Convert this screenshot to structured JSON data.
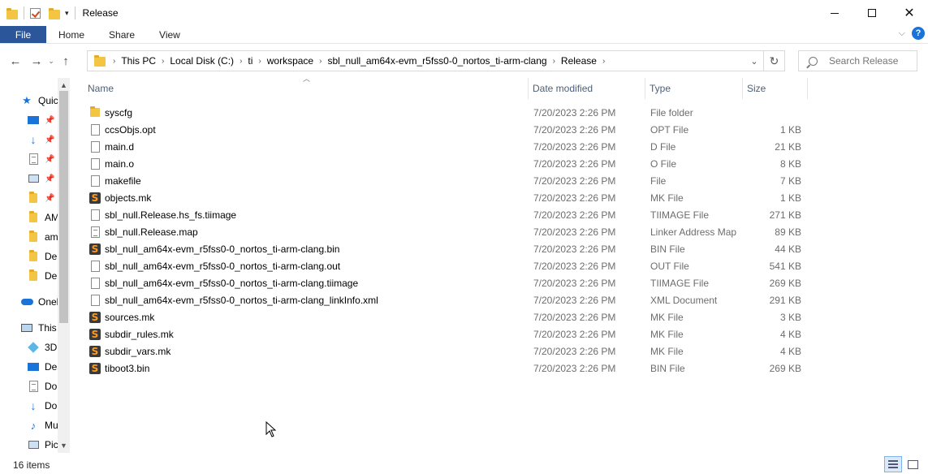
{
  "window": {
    "title": "Release"
  },
  "ribbon": {
    "tabs": [
      {
        "label": "File"
      },
      {
        "label": "Home"
      },
      {
        "label": "Share"
      },
      {
        "label": "View"
      }
    ]
  },
  "address": {
    "crumbs": [
      "This PC",
      "Local Disk (C:)",
      "ti",
      "workspace",
      "sbl_null_am64x-evm_r5fss0-0_nortos_ti-arm-clang",
      "Release"
    ]
  },
  "search": {
    "placeholder": "Search Release"
  },
  "navpane": {
    "items": [
      {
        "label": "Quic",
        "icon": "star-icon"
      },
      {
        "label": "",
        "icon": "desktop-icon",
        "pinned": true
      },
      {
        "label": "",
        "icon": "download-icon",
        "pinned": true
      },
      {
        "label": "",
        "icon": "document-icon",
        "pinned": true
      },
      {
        "label": "",
        "icon": "picture-icon",
        "pinned": true
      },
      {
        "label": "",
        "icon": "folder-icon",
        "pinned": true
      },
      {
        "label": "AM",
        "icon": "folder-icon"
      },
      {
        "label": "am",
        "icon": "folder-icon"
      },
      {
        "label": "Del",
        "icon": "folder-icon"
      },
      {
        "label": "Del",
        "icon": "folder-icon"
      },
      {
        "label": "Onel",
        "icon": "cloud-icon"
      },
      {
        "label": "This",
        "icon": "pc-icon"
      },
      {
        "label": "3D",
        "icon": "3d-objects-icon"
      },
      {
        "label": "Des",
        "icon": "desktop-icon"
      },
      {
        "label": "Do",
        "icon": "document-icon"
      },
      {
        "label": "Do",
        "icon": "download-icon"
      },
      {
        "label": "Mu",
        "icon": "music-icon"
      },
      {
        "label": "Pic",
        "icon": "picture-icon"
      }
    ]
  },
  "columns": {
    "name": "Name",
    "date": "Date modified",
    "type": "Type",
    "size": "Size"
  },
  "files": [
    {
      "name": "syscfg",
      "date": "7/20/2023 2:26 PM",
      "type": "File folder",
      "size": "",
      "icon": "folder-icon"
    },
    {
      "name": "ccsObjs.opt",
      "date": "7/20/2023 2:26 PM",
      "type": "OPT File",
      "size": "1 KB",
      "icon": "file-icon"
    },
    {
      "name": "main.d",
      "date": "7/20/2023 2:26 PM",
      "type": "D File",
      "size": "21 KB",
      "icon": "file-icon"
    },
    {
      "name": "main.o",
      "date": "7/20/2023 2:26 PM",
      "type": "O File",
      "size": "8 KB",
      "icon": "file-icon"
    },
    {
      "name": "makefile",
      "date": "7/20/2023 2:26 PM",
      "type": "File",
      "size": "7 KB",
      "icon": "file-icon"
    },
    {
      "name": "objects.mk",
      "date": "7/20/2023 2:26 PM",
      "type": "MK File",
      "size": "1 KB",
      "icon": "sublime-icon"
    },
    {
      "name": "sbl_null.Release.hs_fs.tiimage",
      "date": "7/20/2023 2:26 PM",
      "type": "TIIMAGE File",
      "size": "271 KB",
      "icon": "file-icon"
    },
    {
      "name": "sbl_null.Release.map",
      "date": "7/20/2023 2:26 PM",
      "type": "Linker Address Map",
      "size": "89 KB",
      "icon": "text-file-icon"
    },
    {
      "name": "sbl_null_am64x-evm_r5fss0-0_nortos_ti-arm-clang.bin",
      "date": "7/20/2023 2:26 PM",
      "type": "BIN File",
      "size": "44 KB",
      "icon": "sublime-icon"
    },
    {
      "name": "sbl_null_am64x-evm_r5fss0-0_nortos_ti-arm-clang.out",
      "date": "7/20/2023 2:26 PM",
      "type": "OUT File",
      "size": "541 KB",
      "icon": "file-icon"
    },
    {
      "name": "sbl_null_am64x-evm_r5fss0-0_nortos_ti-arm-clang.tiimage",
      "date": "7/20/2023 2:26 PM",
      "type": "TIIMAGE File",
      "size": "269 KB",
      "icon": "file-icon"
    },
    {
      "name": "sbl_null_am64x-evm_r5fss0-0_nortos_ti-arm-clang_linkInfo.xml",
      "date": "7/20/2023 2:26 PM",
      "type": "XML Document",
      "size": "291 KB",
      "icon": "file-icon"
    },
    {
      "name": "sources.mk",
      "date": "7/20/2023 2:26 PM",
      "type": "MK File",
      "size": "3 KB",
      "icon": "sublime-icon"
    },
    {
      "name": "subdir_rules.mk",
      "date": "7/20/2023 2:26 PM",
      "type": "MK File",
      "size": "4 KB",
      "icon": "sublime-icon"
    },
    {
      "name": "subdir_vars.mk",
      "date": "7/20/2023 2:26 PM",
      "type": "MK File",
      "size": "4 KB",
      "icon": "sublime-icon"
    },
    {
      "name": "tiboot3.bin",
      "date": "7/20/2023 2:26 PM",
      "type": "BIN File",
      "size": "269 KB",
      "icon": "sublime-icon"
    }
  ],
  "status": {
    "count": "16 items"
  },
  "colors": {
    "file_tab": "#2b579a",
    "folder": "#f4c443",
    "header_text": "#4c607a",
    "meta_text": "#6d6d6d"
  }
}
